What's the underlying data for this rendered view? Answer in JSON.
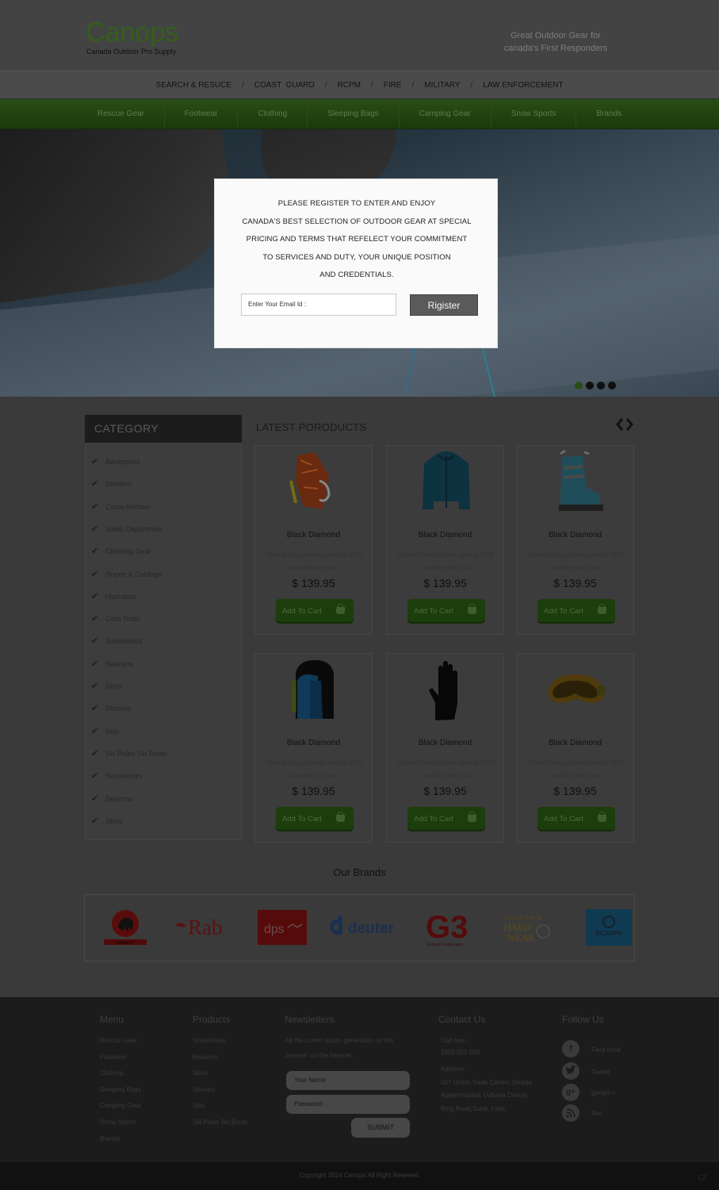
{
  "header": {
    "logo": "Canops",
    "logo_sub": "Canada Outdoor Pro Supply",
    "tagline_line1": "Great Outdoor Gear for",
    "tagline_line2": "canada's First Responders"
  },
  "topnav": [
    "SEARCH & RESUCE",
    "COAST  GUARD",
    "RCPM",
    "FIRE",
    "MILITARY",
    "LAW ENFORCEMENT"
  ],
  "mainnav": [
    "Rescue Gear",
    "Footwear",
    "Clothing",
    "Sleeping Bags",
    "Camping Gear",
    "Snow Sports",
    "Brands"
  ],
  "modal": {
    "line1": "PLEASE REGISTER TO ENTER AND ENJOY",
    "line2": "CANADA'S BEST SELECTION OF OUTDOOR GEAR AT SPECIAL",
    "line3": "PRICING AND TERMS THAT REFELECT YOUR COMMITMENT",
    "line4": "TO SERVICES AND DUTY, YOUR UNIQUE POSITION",
    "line5": "AND CREDENTIALS.",
    "email_placeholder": "Enter Your Email Id :",
    "register_label": "Rigister"
  },
  "slider": {
    "dots": 4,
    "active": 0
  },
  "category": {
    "title": "CATEGORY",
    "items": [
      "Backpacks",
      "Shelters",
      "Camo Kitchen",
      "Sleep Department",
      "Climbing Gear",
      "Ropes & Cordags",
      "Hydration",
      "Core Tools",
      "Snowshoes",
      "Beacons",
      "Skins",
      "Shovels",
      "Skis",
      "Ski Poles Ski Boots",
      "Snowshoes",
      "Beacons",
      "Skins"
    ]
  },
  "products": {
    "title": "LATEST PORODUCTS",
    "arrows": "‹›",
    "items": [
      {
        "name": "Black Diamond",
        "desc": "Overall the customer service VPO provided was  your",
        "price": "$ 139.95",
        "cart": "Add To Cart",
        "icon": "climbing-sling-icon"
      },
      {
        "name": "Black Diamond",
        "desc": "Overall the customer service VPO provided was your",
        "price": "$ 139.95",
        "cart": "Add To Cart",
        "icon": "jacket-icon"
      },
      {
        "name": "Black Diamond",
        "desc": "Overall the customer service VPO provided was your",
        "price": "$ 139.95",
        "cart": "Add To Cart",
        "icon": "ski-boot-icon"
      },
      {
        "name": "Black Diamond",
        "desc": "Overall the customer service VPO provided was  your",
        "price": "$ 139.95",
        "cart": "Add To Cart",
        "icon": "backpack-icon"
      },
      {
        "name": "Black Diamond",
        "desc": "Overall the customer service VPO provided was your",
        "price": "$ 139.95",
        "cart": "Add To Cart",
        "icon": "glove-icon"
      },
      {
        "name": "Black Diamond",
        "desc": "Overall the customer service VPO provided was your",
        "price": "$ 139.95",
        "cart": "Add To Cart",
        "icon": "goggles-icon"
      }
    ]
  },
  "brands": {
    "title": "Our Brands",
    "logos": [
      "MAMMUT",
      "Rab",
      "dps",
      "deuter",
      "G3",
      "MOUNTAIN HARD WEAR",
      "SCARPA"
    ]
  },
  "footer": {
    "menu": {
      "title": "Menu",
      "links": [
        "Rescue Gear",
        "Footwear",
        "Clothing",
        "Sleeping Bags",
        "Camping Gear",
        "Snow Sports",
        "Brands"
      ]
    },
    "products": {
      "title": "Products",
      "links": [
        "Snowshoes",
        "Beacons",
        "Skins",
        "Shovels",
        "Skis",
        "Ski Poles Ski Boots"
      ]
    },
    "newsletters": {
      "title": "Newsletters",
      "text1": "All the Lorem Ipsum generators on the",
      "text2": "Internet  on the Internet.",
      "name_placeholder": "Your Name :",
      "password_placeholder": "Password :",
      "submit": "SUBMIT"
    },
    "contact": {
      "title": "Contact Us",
      "call_label": "Call now :",
      "phone": "1800 555 000",
      "address_label": "Address :",
      "addr1": "507-Union Trade Centre, Beside",
      "addr2": "AppleHospital, Udhana Darwaj",
      "addr3": "Ring Road,Surat, India."
    },
    "follow": {
      "title": "Follow Us",
      "items": [
        "Face book",
        "Twitter",
        "google +",
        "Rss"
      ]
    },
    "copyright": "Copyright 2014 Canops.All Right Reseved.",
    "corner": "C2"
  }
}
